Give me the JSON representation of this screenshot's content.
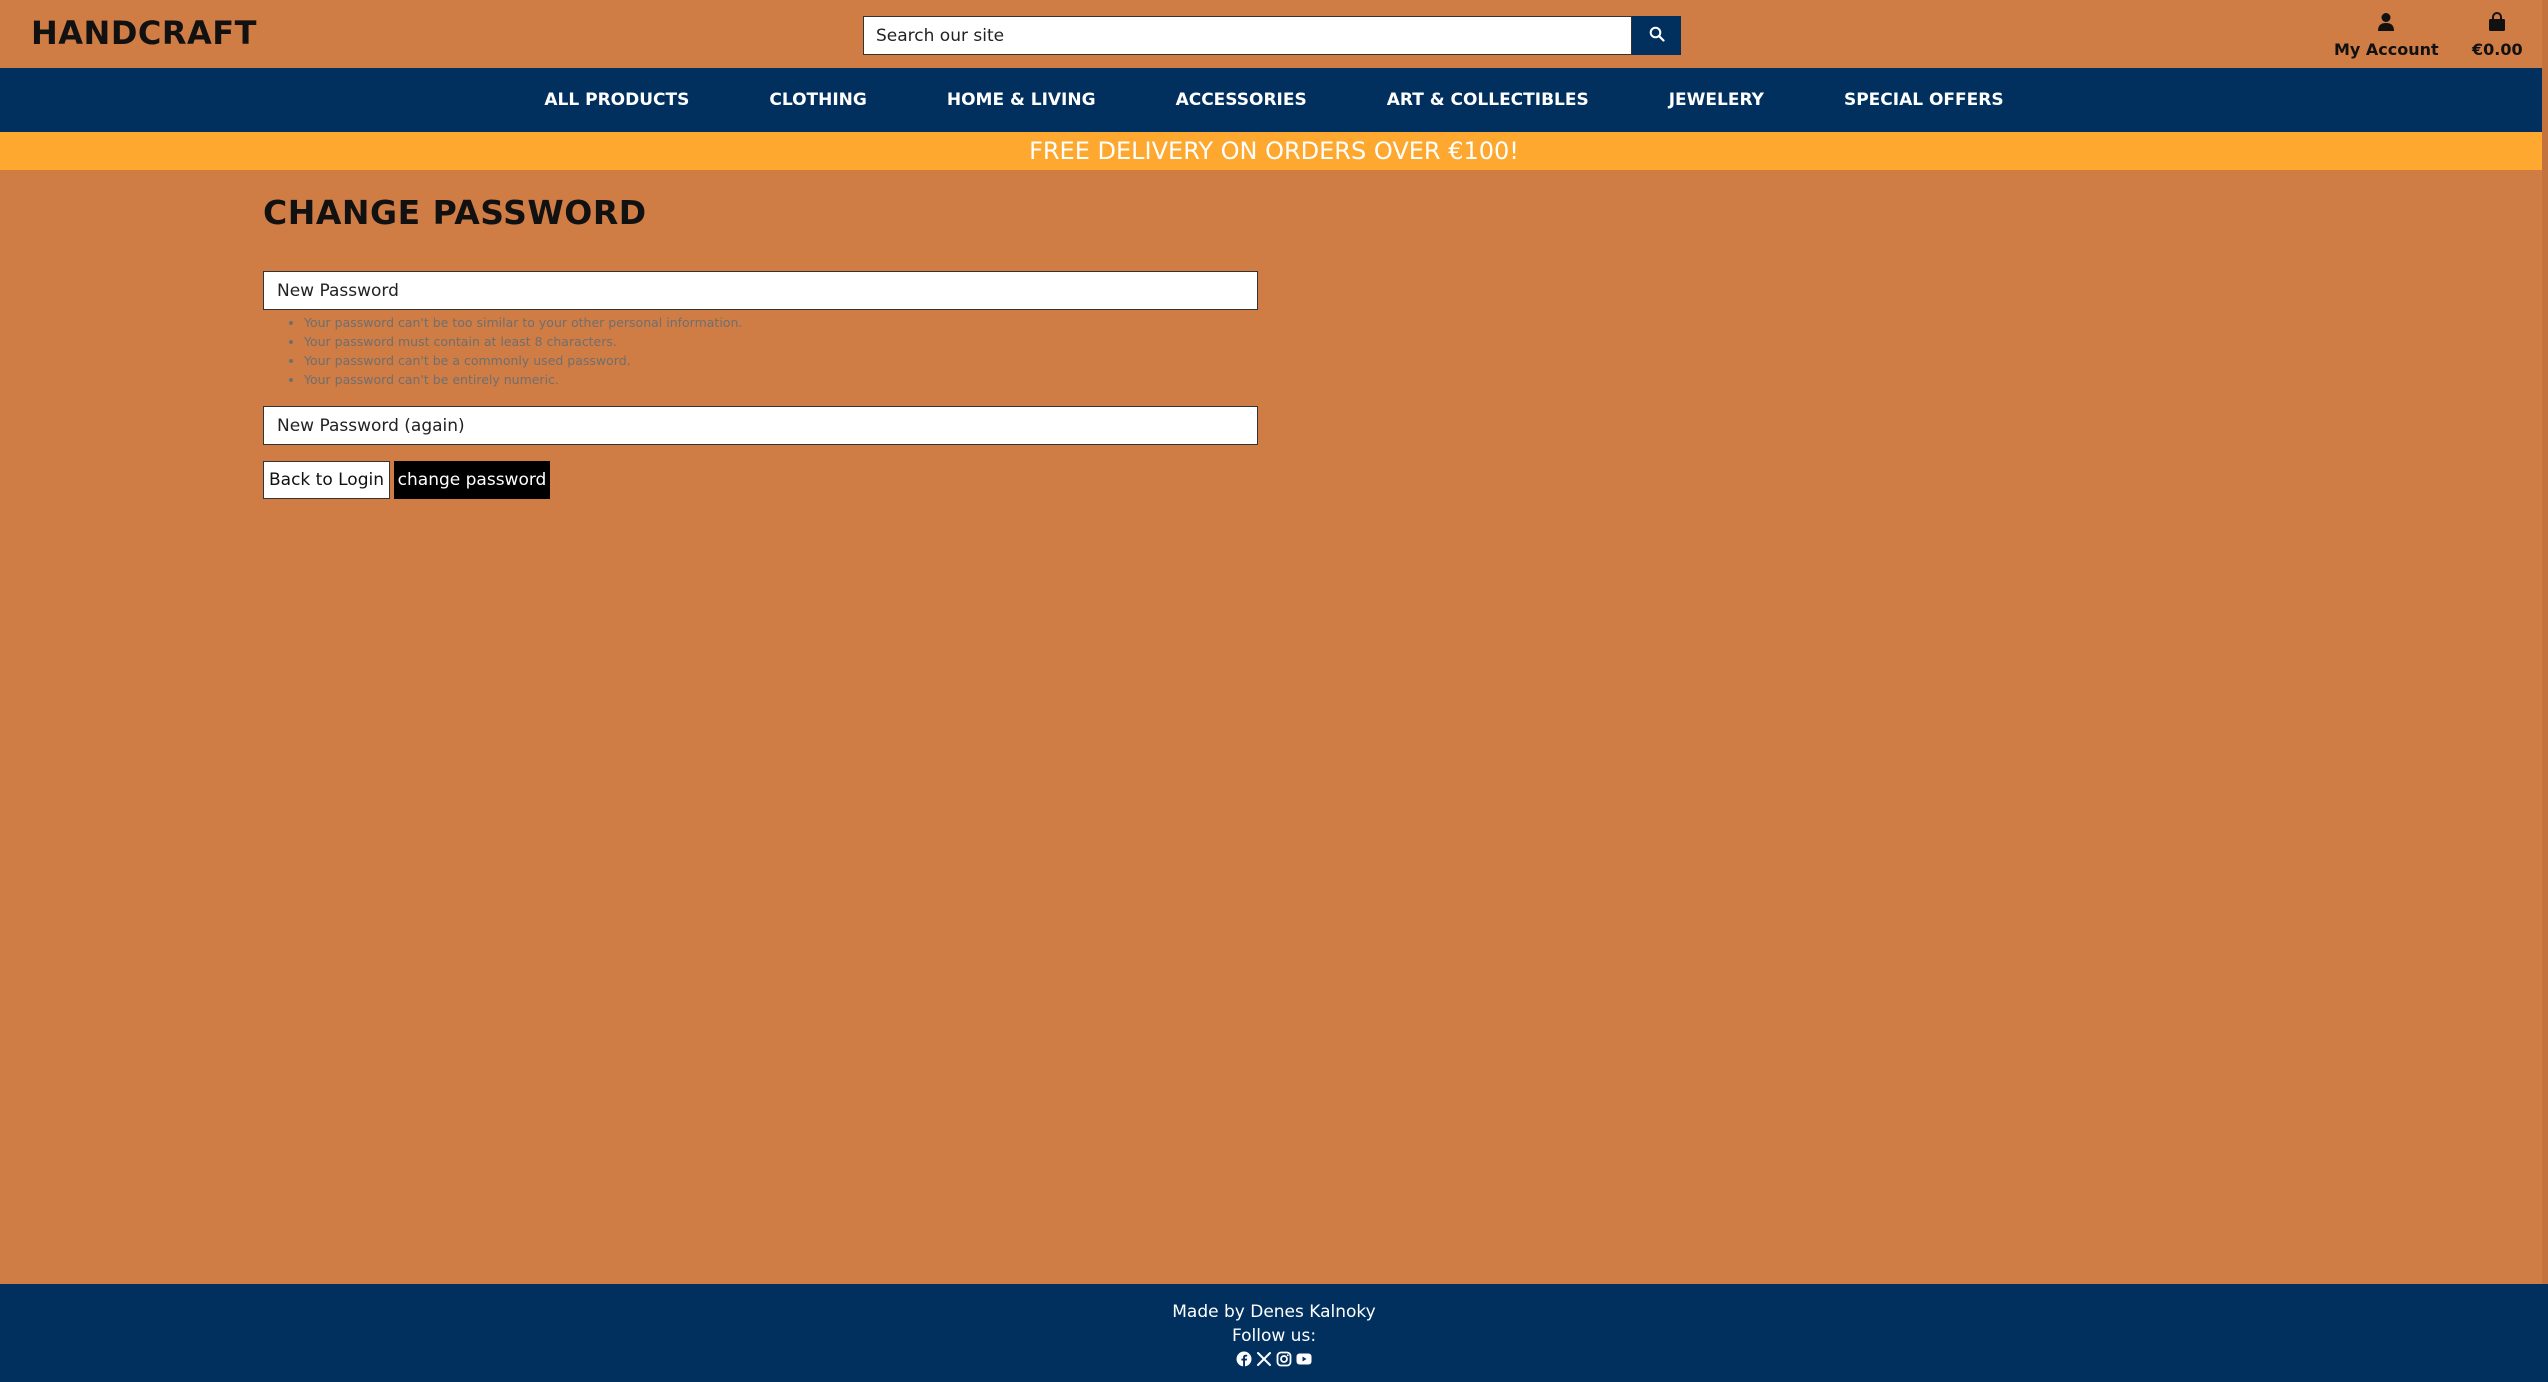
{
  "header": {
    "brand": "HANDCRAFT",
    "search_placeholder": "Search our site",
    "account_label": "My Account",
    "cart_total": "€0.00"
  },
  "nav": {
    "items": [
      "ALL PRODUCTS",
      "CLOTHING",
      "HOME & LIVING",
      "ACCESSORIES",
      "ART & COLLECTIBLES",
      "JEWELERY",
      "SPECIAL OFFERS"
    ]
  },
  "banner": "FREE DELIVERY ON ORDERS OVER €100!",
  "main": {
    "title": "CHANGE PASSWORD",
    "password1_placeholder": "New Password",
    "password2_placeholder": "New Password (again)",
    "help": [
      "Your password can't be too similar to your other personal information.",
      "Your password must contain at least 8 characters.",
      "Your password can't be a commonly used password.",
      "Your password can't be entirely numeric."
    ],
    "back_label": "Back to Login",
    "submit_label": "change password"
  },
  "footer": {
    "made_by": "Made by Denes Kalnoky",
    "follow": "Follow us:",
    "social_icons": [
      "facebook-icon",
      "x-icon",
      "instagram-icon",
      "youtube-icon"
    ]
  },
  "colors": {
    "page_bg": "#d07c45",
    "nav_bg": "#01305f",
    "banner_bg": "#fea82f"
  }
}
